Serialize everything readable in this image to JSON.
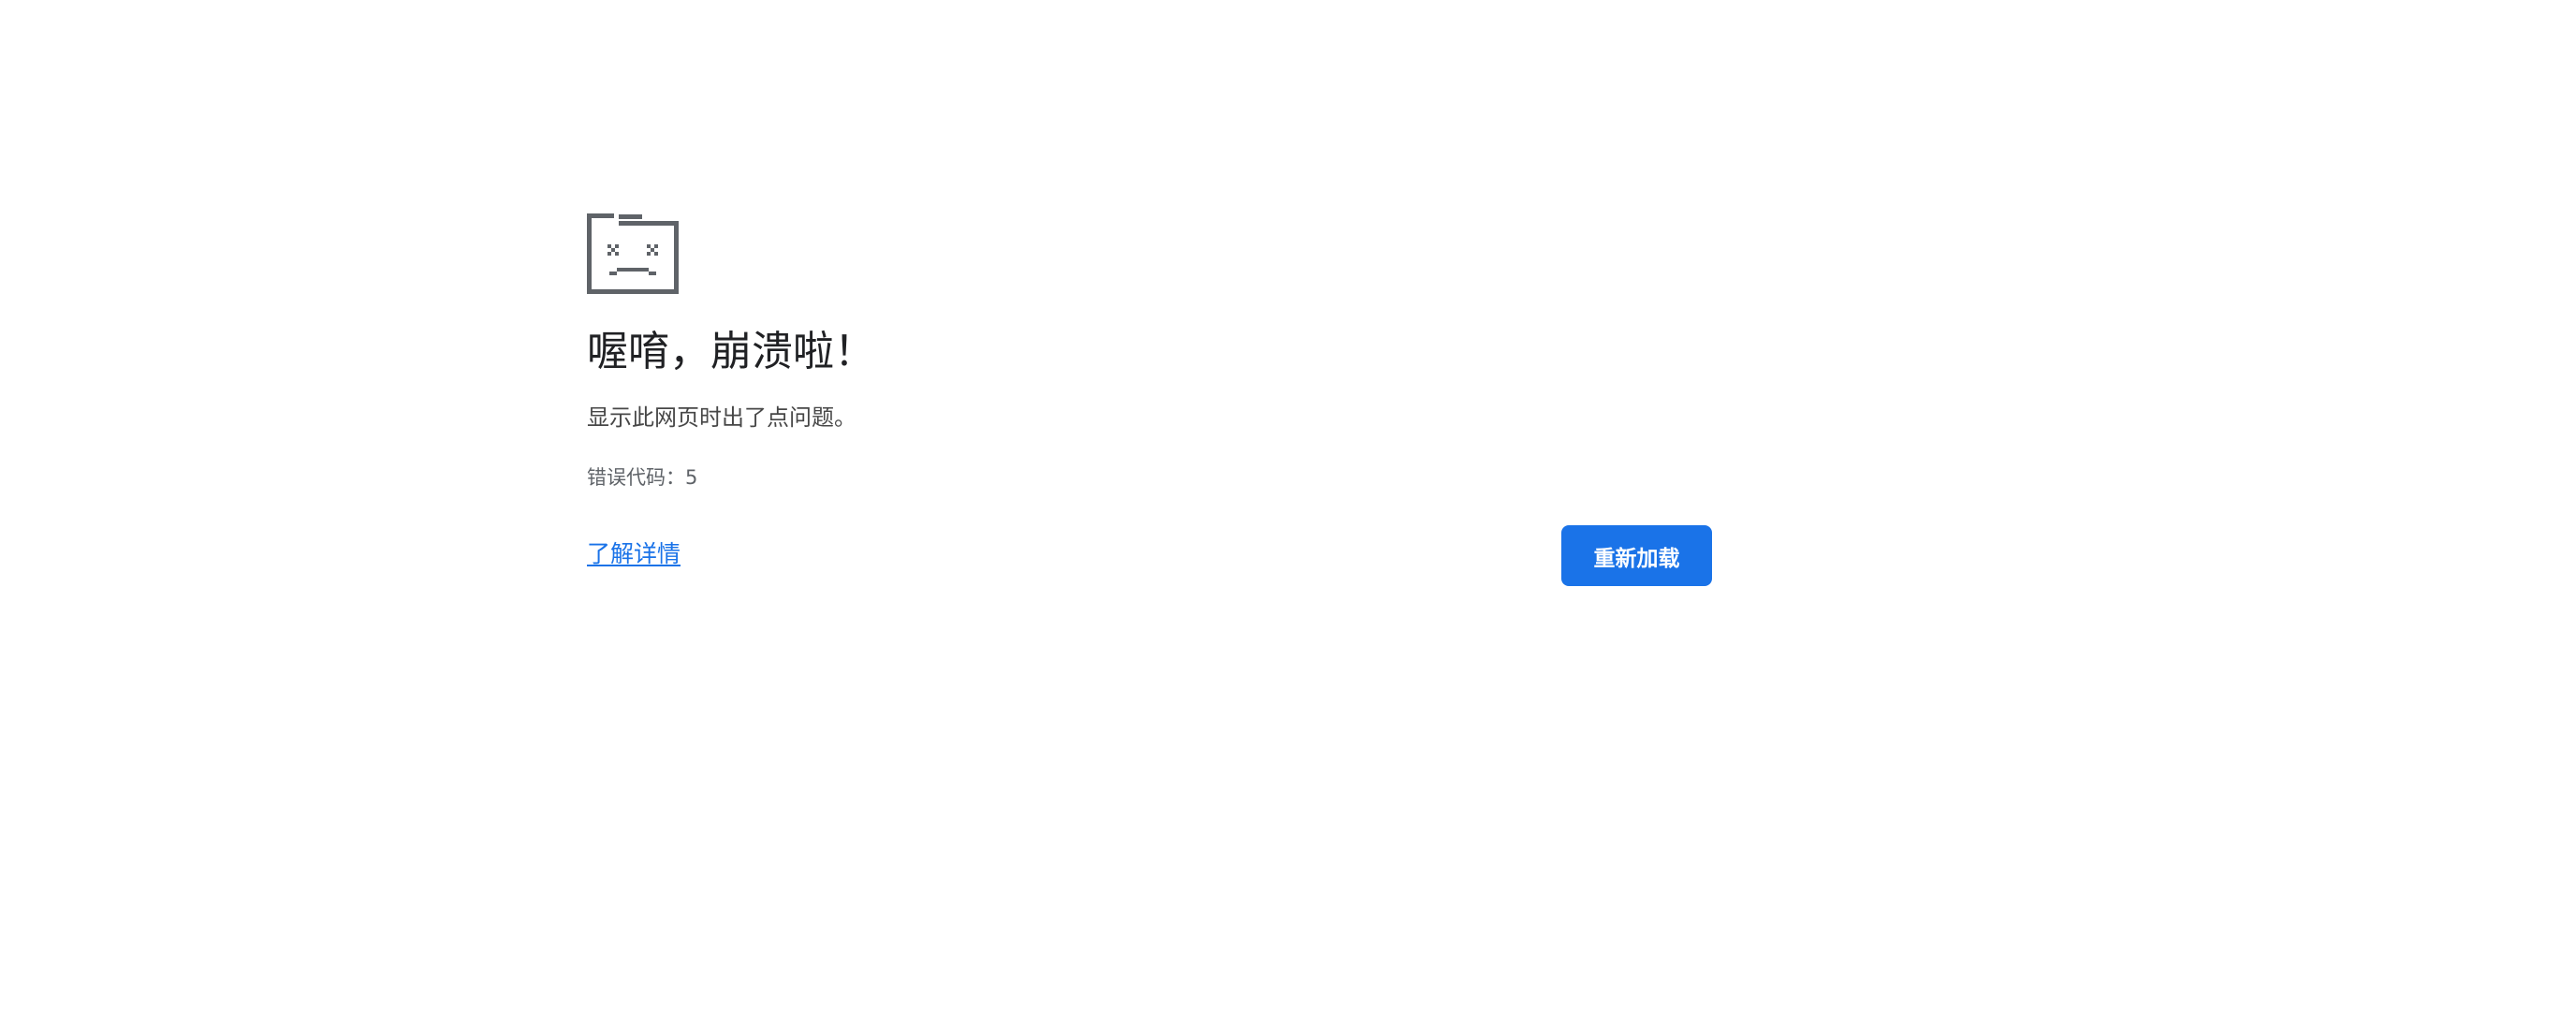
{
  "error_page": {
    "icon": "sad-tab-folder-icon",
    "headline": "喔唷，崩溃啦！",
    "message": "显示此网页时出了点问题。",
    "error_code": "错误代码：5",
    "learn_more_label": "了解详情",
    "reload_label": "重新加载"
  },
  "colors": {
    "accent": "#1a73e8",
    "headline": "#202124",
    "body_text": "#474747",
    "icon": "#5f6368",
    "background": "#ffffff"
  }
}
